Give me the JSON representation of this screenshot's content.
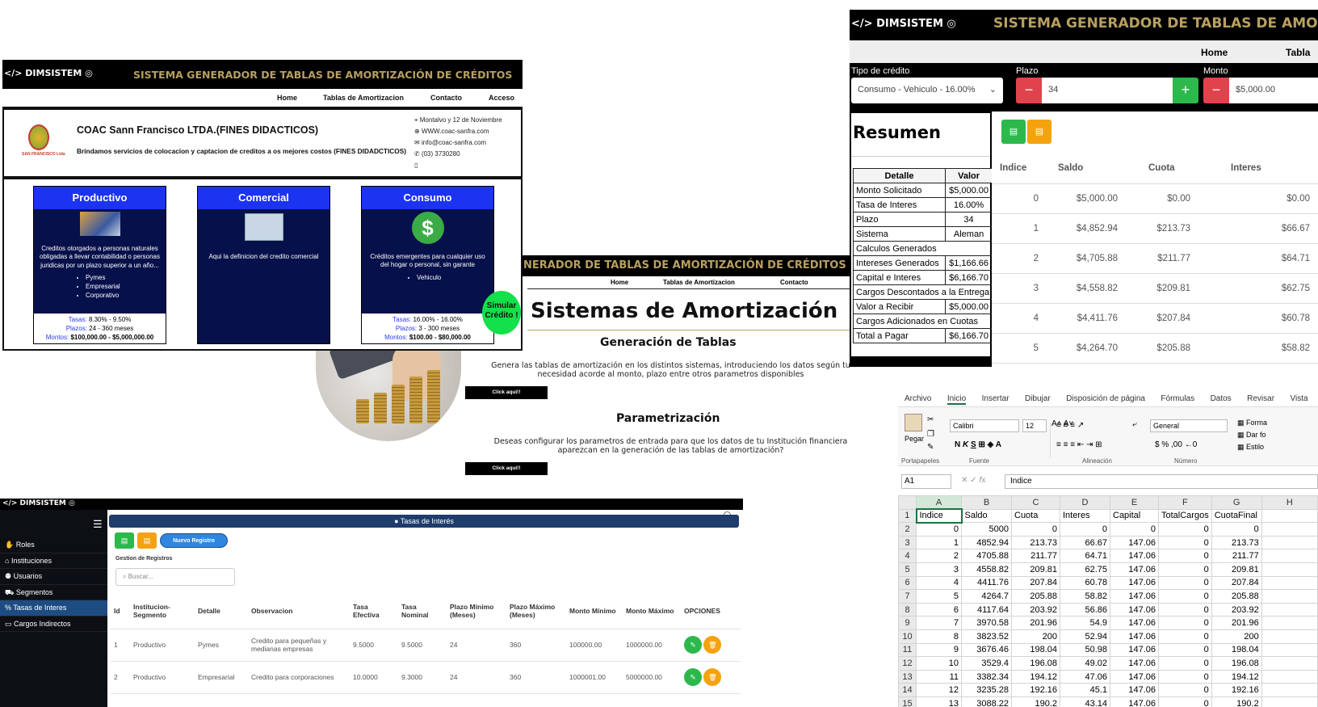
{
  "logo_text": "DIMSISTEM",
  "site_title": "SISTEMA GENERADOR DE TABLAS DE AMORTIZACIÓN DE CRÉDITOS",
  "site_title_short": "SISTEMA GENERADOR DE TABLAS DE AMO",
  "site_title_mid": "NERADOR DE TABLAS DE AMORTIZACIÓN DE CRÉDITOS",
  "nav": {
    "home": "Home",
    "tablas": "Tablas de Amortizacion",
    "contacto": "Contacto",
    "acceso": "Acceso",
    "tabla_short": "Tabla"
  },
  "coop": {
    "logo_caption": "SAN FRANCISCO Ltda",
    "name": "COAC Sann Francisco LTDA.(FINES DIDACTICOS)",
    "tagline": "Brindamos servicios de colocacion y captacion de creditos a os mejores costos (FINES DIDADCTICOS)",
    "address": "Montalvo y 12 de Noviembre",
    "web": "WWW.coac-sanfra.com",
    "email": "info@coac-sanfra.com",
    "phone": "(03) 3730280"
  },
  "cards": [
    {
      "title": "Productivo",
      "desc": "Creditos otorgados a personas naturales obligadas a llevar contabilidad o personas juridicas por un plazo superior a un año...",
      "items": [
        "Pymes",
        "Empresarial",
        "Corporativo"
      ],
      "tasas": "8.30% - 9.50%",
      "plazos": "24 - 360 meses",
      "montos": "$100,000.00 - $5,000,000.00"
    },
    {
      "title": "Comercial",
      "desc": "Aqui la definicion del credito comercial"
    },
    {
      "title": "Consumo",
      "desc": "Créditos emergentes para cualquier uso del hogar o personal, sin garante",
      "items": [
        "Vehiculo"
      ],
      "tasas": "16.00% - 16.00%",
      "plazos": "3 - 300 meses",
      "montos": "$100.00 - $80,000.00"
    }
  ],
  "labels": {
    "tasas": "Tasas:",
    "plazos": "Plazos:",
    "montos": "Montos:"
  },
  "simular": {
    "line1": "Simular",
    "line2": "Crédito !"
  },
  "center": {
    "heading": "Sistemas de Amortización",
    "gen_title": "Generación de Tablas",
    "gen_text": "Genera las tablas de amortización en los distintos sistemas, introduciendo los datos según tu necesidad acorde al monto, plazo entre otros parametros disponibles",
    "param_title": "Parametrización",
    "param_text": "Deseas configurar los parametros de entrada para que los datos de tu Institución financiera aparezcan en la generación de las tablas de amortización?",
    "btn": "Click aqui!!"
  },
  "sim": {
    "tipo_label": "Tipo de crédito",
    "tipo_value": "Consumo - Vehiculo - 16.00%",
    "plazo_label": "Plazo",
    "plazo_value": "34",
    "monto_label": "Monto",
    "monto_value": "$5,000.00",
    "resumen_title": "Resumen",
    "th_detalle": "Detalle",
    "th_valor": "Valor",
    "rows": [
      [
        "Monto Solicitado",
        "$5,000.00"
      ],
      [
        "Tasa de Interes",
        "16.00%"
      ],
      [
        "Plazo",
        "34"
      ],
      [
        "Sistema",
        "Aleman"
      ],
      [
        "Calculos Generados",
        ""
      ],
      [
        "Intereses Generados",
        "$1,166.66"
      ],
      [
        "Capital e Interes",
        "$6,166.70"
      ],
      [
        "Cargos Descontados a la Entrega",
        ""
      ],
      [
        "Valor a Recibir",
        "$5,000.00"
      ],
      [
        "Cargos Adicionados en Cuotas",
        ""
      ],
      [
        "Total a Pagar",
        "$6,166.70"
      ]
    ],
    "amort_headers": [
      "Indice",
      "Saldo",
      "Cuota",
      "Interes"
    ],
    "amort_rows": [
      [
        "0",
        "$5,000.00",
        "$0.00",
        "$0.00"
      ],
      [
        "1",
        "$4,852.94",
        "$213.73",
        "$66.67"
      ],
      [
        "2",
        "$4,705.88",
        "$211.77",
        "$64.71"
      ],
      [
        "3",
        "$4,558.82",
        "$209.81",
        "$62.75"
      ],
      [
        "4",
        "$4,411.76",
        "$207.84",
        "$60.78"
      ],
      [
        "5",
        "$4,264.70",
        "$205.88",
        "$58.82"
      ]
    ]
  },
  "admin": {
    "menu": [
      "Roles",
      "Instituciones",
      "Usuarios",
      "Segmentos",
      "Tasas de Interes",
      "Cargos Indirectos"
    ],
    "page_title": "Tasas de Interés",
    "nuevo": "Nuevo Registro",
    "gestion": "Gestion de Registros",
    "search_placeholder": "Buscar...",
    "headers": [
      "Id",
      "Institucion-Segmento",
      "Detalle",
      "Observacion",
      "Tasa Efectiva",
      "Tasa Nominal",
      "Plazo Mínimo (Meses)",
      "Plazo Máximo (Meses)",
      "Monto Mínimo",
      "Monto Máximo",
      "OPCIONES"
    ],
    "rows": [
      [
        "1",
        "Productivo",
        "Pymes",
        "Credito para pequeñas y medianas empresas",
        "9.5000",
        "9.5000",
        "24",
        "360",
        "100000.00",
        "1000000.00"
      ],
      [
        "2",
        "Productivo",
        "Empresarial",
        "Credito para corporaciones",
        "10.0000",
        "9.3000",
        "24",
        "360",
        "1000001.00",
        "5000000.00"
      ]
    ]
  },
  "excel": {
    "tabs": [
      "Archivo",
      "Inicio",
      "Insertar",
      "Dibujar",
      "Disposición de página",
      "Fórmulas",
      "Datos",
      "Revisar",
      "Vista",
      "A"
    ],
    "font": "Calibri",
    "size": "12",
    "format": "General",
    "paste": "Pegar",
    "groups": [
      "Portapapeles",
      "Fuente",
      "Alineación",
      "Número"
    ],
    "side": [
      "Forma",
      "Dar fo",
      "Estilo"
    ],
    "cellref": "A1",
    "formula": "Indice",
    "cols": [
      "A",
      "B",
      "C",
      "D",
      "E",
      "F",
      "G",
      "H"
    ],
    "header_row": [
      "Indice",
      "Saldo",
      "Cuota",
      "Interes",
      "Capital",
      "TotalCargos",
      "CuotaFinal",
      ""
    ],
    "rows": [
      [
        "0",
        "5000",
        "0",
        "0",
        "0",
        "0",
        "0"
      ],
      [
        "1",
        "4852.94",
        "213.73",
        "66.67",
        "147.06",
        "0",
        "213.73"
      ],
      [
        "2",
        "4705.88",
        "211.77",
        "64.71",
        "147.06",
        "0",
        "211.77"
      ],
      [
        "3",
        "4558.82",
        "209.81",
        "62.75",
        "147.06",
        "0",
        "209.81"
      ],
      [
        "4",
        "4411.76",
        "207.84",
        "60.78",
        "147.06",
        "0",
        "207.84"
      ],
      [
        "5",
        "4264.7",
        "205.88",
        "58.82",
        "147.06",
        "0",
        "205.88"
      ],
      [
        "6",
        "4117.64",
        "203.92",
        "56.86",
        "147.06",
        "0",
        "203.92"
      ],
      [
        "7",
        "3970.58",
        "201.96",
        "54.9",
        "147.06",
        "0",
        "201.96"
      ],
      [
        "8",
        "3823.52",
        "200",
        "52.94",
        "147.06",
        "0",
        "200"
      ],
      [
        "9",
        "3676.46",
        "198.04",
        "50.98",
        "147.06",
        "0",
        "198.04"
      ],
      [
        "10",
        "3529.4",
        "196.08",
        "49.02",
        "147.06",
        "0",
        "196.08"
      ],
      [
        "11",
        "3382.34",
        "194.12",
        "47.06",
        "147.06",
        "0",
        "194.12"
      ],
      [
        "12",
        "3235.28",
        "192.16",
        "45.1",
        "147.06",
        "0",
        "192.16"
      ],
      [
        "13",
        "3088.22",
        "190.2",
        "43.14",
        "147.06",
        "0",
        "190.2"
      ]
    ]
  }
}
